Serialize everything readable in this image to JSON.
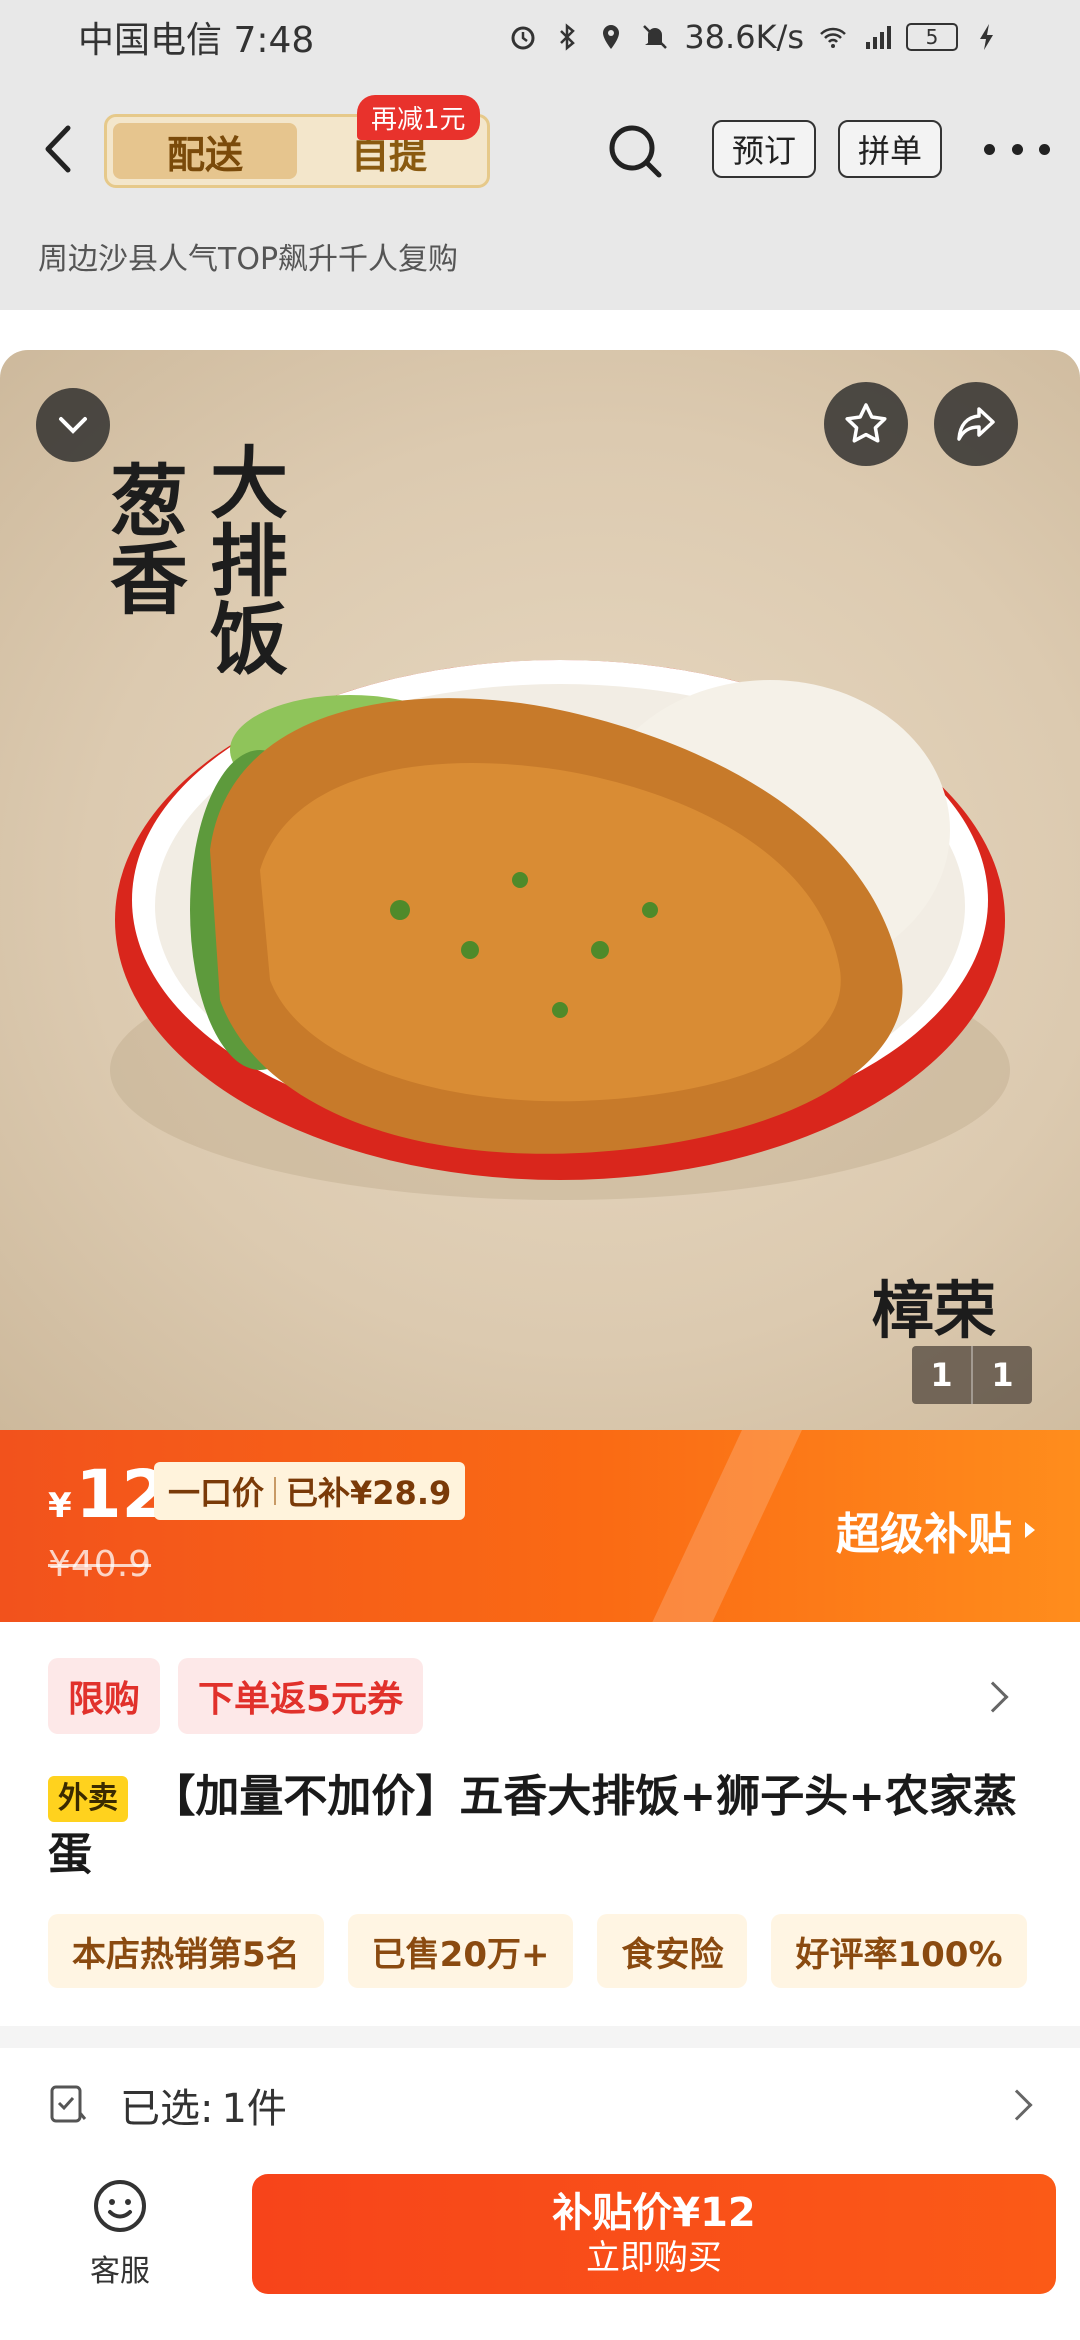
{
  "status_bar": {
    "carrier_time": "中国电信 7:48",
    "net_speed": "38.6K/s",
    "battery": "5"
  },
  "nav": {
    "tab_delivery": "配送",
    "tab_pickup": "自提",
    "pickup_badge": "再减1元",
    "reserve_label": "预订",
    "group_label": "拼单"
  },
  "store_slogan": "周边沙县人气TOP飙升千人复购",
  "hero": {
    "title_line1": "大排饭",
    "title_line2": "葱香",
    "brand": "樟荣",
    "page_current": "1",
    "page_total": "1"
  },
  "price": {
    "currency": "¥",
    "current": "12",
    "tag_fixed": "一口价",
    "tag_subsidy": "已补¥28.9",
    "original": "¥40.9",
    "super_subsidy": "超级补贴"
  },
  "promo_tags": [
    "限购",
    "下单返5元券"
  ],
  "product": {
    "channel_badge": "外卖",
    "title": "【加量不加价】五香大排饭+狮子头+农家蒸蛋"
  },
  "features": [
    "本店热销第5名",
    "已售20万+",
    "食安险",
    "好评率100%"
  ],
  "selection": {
    "label": "已选:",
    "value": "1件"
  },
  "bottom": {
    "service_label": "客服",
    "buy_price": "补贴价¥12",
    "buy_label": "立即购买"
  },
  "colors": {
    "accent_orange": "#f7441a",
    "tag_red": "#e1312b",
    "gold": "#e6c58e"
  }
}
